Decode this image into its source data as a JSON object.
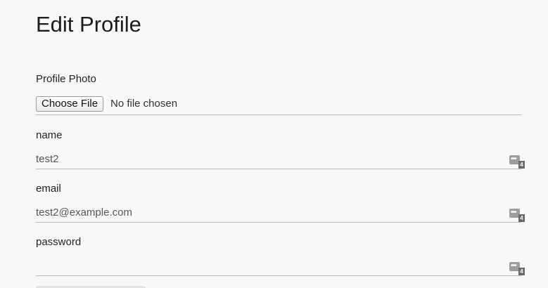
{
  "page": {
    "title": "Edit Profile"
  },
  "photo": {
    "label": "Profile Photo",
    "button_label": "Choose File",
    "status": "No file chosen"
  },
  "fields": {
    "name": {
      "label": "name",
      "value": "test2"
    },
    "email": {
      "label": "email",
      "value": "test2@example.com"
    },
    "password": {
      "label": "password",
      "value": ""
    }
  },
  "field_icon": {
    "name": "password-manager-icon",
    "dots": "•••",
    "badge": "4"
  }
}
